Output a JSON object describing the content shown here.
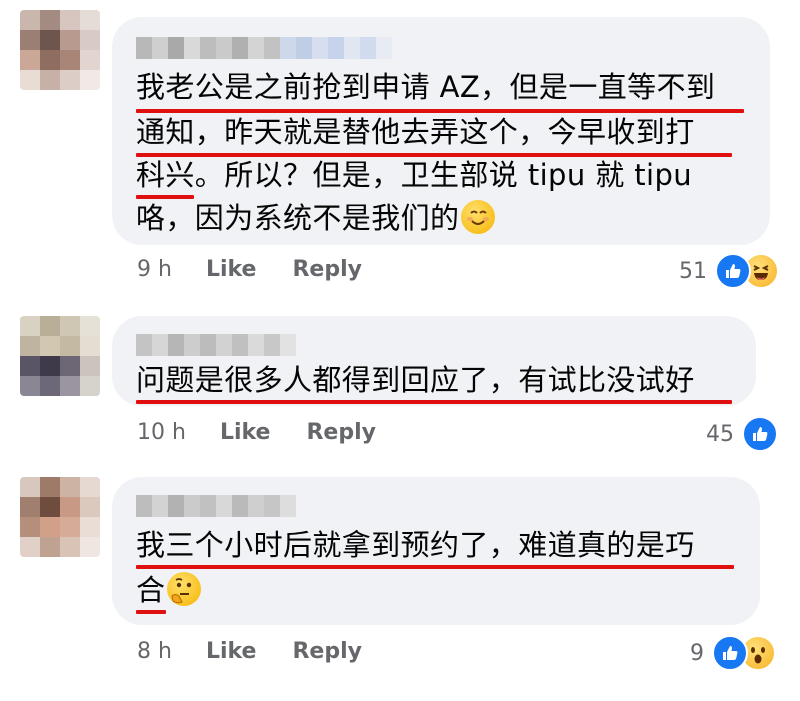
{
  "comments": [
    {
      "lines": [
        "我老公是之前抢到申请 AZ，但是一直等不到",
        "通知，昨天就是替他去弄这个，今早收到打",
        "科兴。所以？但是，卫生部说 tipu 就 tipu",
        "咯，因为系统不是我们的"
      ],
      "emoji": "smiling-face",
      "time": "9 h",
      "like_label": "Like",
      "reply_label": "Reply",
      "reaction_count": "51",
      "reactions": [
        "like-icon",
        "haha-icon"
      ]
    },
    {
      "lines": [
        "问题是很多人都得到回应了，有试比没试好"
      ],
      "time": "10 h",
      "like_label": "Like",
      "reply_label": "Reply",
      "reaction_count": "45",
      "reactions": [
        "like-icon"
      ]
    },
    {
      "lines": [
        "我三个小时后就拿到预约了，难道真的是巧",
        "合"
      ],
      "emoji": "thinking-face",
      "time": "8 h",
      "like_label": "Like",
      "reply_label": "Reply",
      "reaction_count": "9",
      "reactions": [
        "like-icon",
        "wow-icon"
      ]
    }
  ],
  "colors": {
    "bubble": "#f0f2f5",
    "underline": "#e01010",
    "like_blue": "#1877f2",
    "meta_text": "#65676b"
  }
}
